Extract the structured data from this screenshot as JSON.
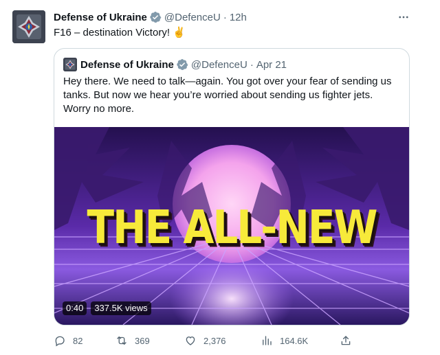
{
  "tweet": {
    "author_name": "Defense of Ukraine",
    "handle": "@DefenceU",
    "dot": "·",
    "time": "12h",
    "text": "F16 – destination Victory!",
    "emoji": "✌️"
  },
  "quote": {
    "author_name": "Defense of Ukraine",
    "handle": "@DefenceU",
    "dot": "·",
    "time": "Apr 21",
    "text": "Hey there. We need to talk—again. You got over your fear of sending us tanks. But now we hear you’re worried about sending us fighter jets. Worry no more.",
    "video": {
      "title_overlay": "THE ALL-NEW",
      "duration": "0:40",
      "views": "337.5K views"
    }
  },
  "actions": {
    "replies": "82",
    "reposts": "369",
    "likes": "2,376",
    "views": "164.6K"
  },
  "icons": {
    "verified": "verified-badge-icon",
    "more": "more-options-icon",
    "reply": "reply-icon",
    "repost": "repost-icon",
    "like": "heart-icon",
    "views": "analytics-icon",
    "share": "share-icon"
  },
  "colors": {
    "text": "#0f1419",
    "secondary": "#536471",
    "border": "#cfd9de",
    "verified": "#829aab",
    "overlay_text": "#f7ea3a"
  }
}
